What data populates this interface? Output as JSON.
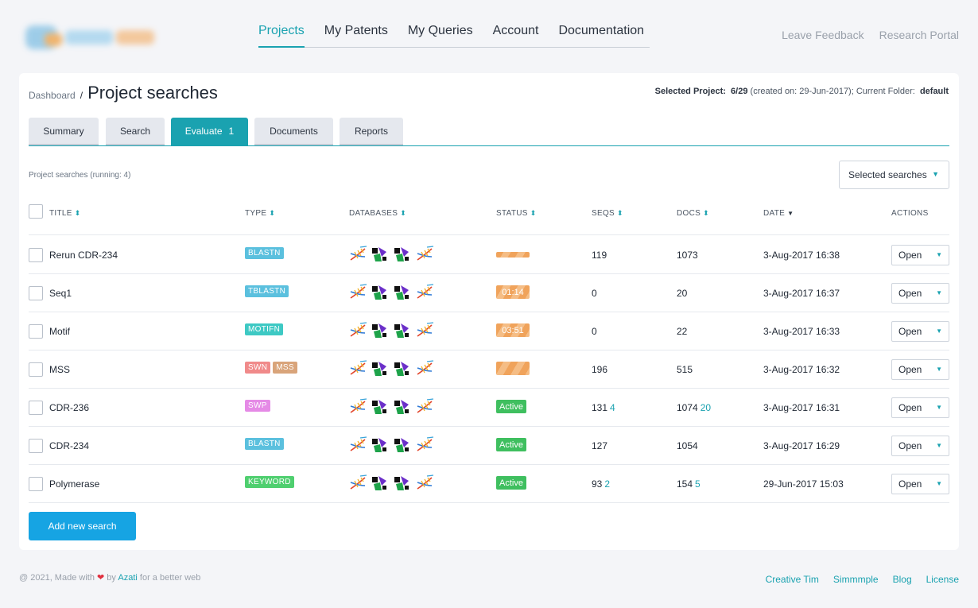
{
  "nav": {
    "items": [
      "Projects",
      "My Patents",
      "My Queries",
      "Account",
      "Documentation"
    ],
    "active_index": 0
  },
  "right_links": [
    "Leave Feedback",
    "Research Portal"
  ],
  "page": {
    "breadcrumb": "Dashboard",
    "separator": "/",
    "title": "Project searches",
    "project_info": {
      "label": "Selected Project:",
      "value": "6/29",
      "created": "(created on: 29-Jun-2017); Current Folder:",
      "folder": "default"
    }
  },
  "tabs": [
    {
      "label": "Summary",
      "badge": ""
    },
    {
      "label": "Search",
      "badge": ""
    },
    {
      "label": "Evaluate",
      "badge": "1"
    },
    {
      "label": "Documents",
      "badge": ""
    },
    {
      "label": "Reports",
      "badge": ""
    }
  ],
  "running_label": "Project searches (running: 4)",
  "selected_searches": "Selected searches",
  "columns": {
    "title": "TITLE",
    "type": "TYPE",
    "databases": "DATABASES",
    "status": "STATUS",
    "seqs": "SEQS",
    "docs": "DOCS",
    "date": "DATE",
    "actions": "ACTIONS"
  },
  "type_colors": {
    "BLASTN": "#5bc0de",
    "TBLASTN": "#5bc0de",
    "MOTIFN": "#3ec9c4",
    "SWN": "#f08a8a",
    "MSS": "#d9a47a",
    "SWP": "#e58ae6",
    "KEYWORD": "#4fcf6f"
  },
  "rows": [
    {
      "title": "Rerun CDR-234",
      "types": [
        "BLASTN"
      ],
      "status": {
        "kind": "progress",
        "text": "",
        "progress": 0.35
      },
      "seqs": "119",
      "seqs_new": "",
      "docs": "1073",
      "docs_new": "",
      "date": "3-Aug-2017 16:38",
      "action": "Open"
    },
    {
      "title": "Seq1",
      "types": [
        "TBLASTN"
      ],
      "status": {
        "kind": "progress",
        "text": "01:14",
        "progress": 0.35
      },
      "seqs": "0",
      "seqs_new": "",
      "docs": "20",
      "docs_new": "",
      "date": "3-Aug-2017 16:37",
      "action": "Open"
    },
    {
      "title": "Motif",
      "types": [
        "MOTIFN"
      ],
      "status": {
        "kind": "progress",
        "text": "03:51",
        "progress": 0.35
      },
      "seqs": "0",
      "seqs_new": "",
      "docs": "22",
      "docs_new": "",
      "date": "3-Aug-2017 16:33",
      "action": "Open"
    },
    {
      "title": "MSS",
      "types": [
        "SWN",
        "MSS"
      ],
      "status": {
        "kind": "progress",
        "text": "",
        "progress": 0.35
      },
      "seqs": "196",
      "seqs_new": "",
      "docs": "515",
      "docs_new": "",
      "date": "3-Aug-2017 16:32",
      "action": "Open"
    },
    {
      "title": "CDR-236",
      "types": [
        "SWP"
      ],
      "status": {
        "kind": "active",
        "text": "Active"
      },
      "seqs": "131",
      "seqs_new": "4",
      "docs": "1074",
      "docs_new": "20",
      "date": "3-Aug-2017 16:31",
      "action": "Open"
    },
    {
      "title": "CDR-234",
      "types": [
        "BLASTN"
      ],
      "status": {
        "kind": "active",
        "text": "Active"
      },
      "seqs": "127",
      "seqs_new": "",
      "docs": "1054",
      "docs_new": "",
      "date": "3-Aug-2017 16:29",
      "action": "Open"
    },
    {
      "title": "Polymerase",
      "types": [
        "KEYWORD"
      ],
      "status": {
        "kind": "active",
        "text": "Active"
      },
      "seqs": "93",
      "seqs_new": "2",
      "docs": "154",
      "docs_new": "5",
      "date": "29-Jun-2017 15:03",
      "action": "Open"
    }
  ],
  "database_icons": [
    "dna-icon",
    "molecule-icon",
    "molecule-icon",
    "dna-icon"
  ],
  "add_button": "Add new search",
  "footer": {
    "prefix": "@ 2021, Made with",
    "by": "by",
    "brand": "Azati",
    "suffix": "for a better web",
    "links": [
      "Creative Tim",
      "Simmmple",
      "Blog",
      "License"
    ]
  }
}
